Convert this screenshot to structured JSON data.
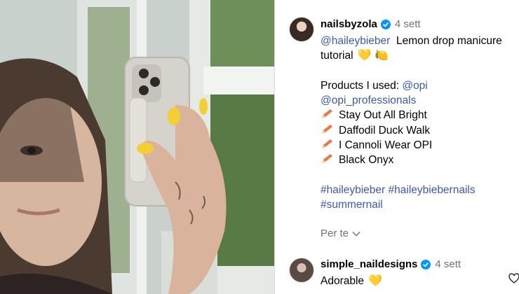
{
  "post": {
    "author": "nailsbyzola",
    "time": "4 sett",
    "caption": {
      "mention": "@haileybieber",
      "title_1": "Lemon drop manicure",
      "title_2": "tutorial",
      "title_emojis": "💛 🍋",
      "products_label": "Products I used:",
      "mention_opi": "@opi",
      "mention_opi_pro": "@opi_professionals",
      "products": [
        "Stay Out All Bright",
        "Daffodil Duck Walk",
        "I Cannoli Wear OPI",
        "Black Onyx"
      ],
      "hashtags_1": "#haileybieber #haileybiebernails",
      "hashtags_2": "#summernail"
    },
    "translation_link": "Per te"
  },
  "comment": {
    "author": "simple_naildesigns",
    "time": "4 sett",
    "text": "Adorable",
    "emoji": "💛"
  },
  "colors": {
    "link": "#3b5aa9",
    "verified": "#0095f6",
    "muted": "#737373",
    "pencil": "#e8774a"
  }
}
